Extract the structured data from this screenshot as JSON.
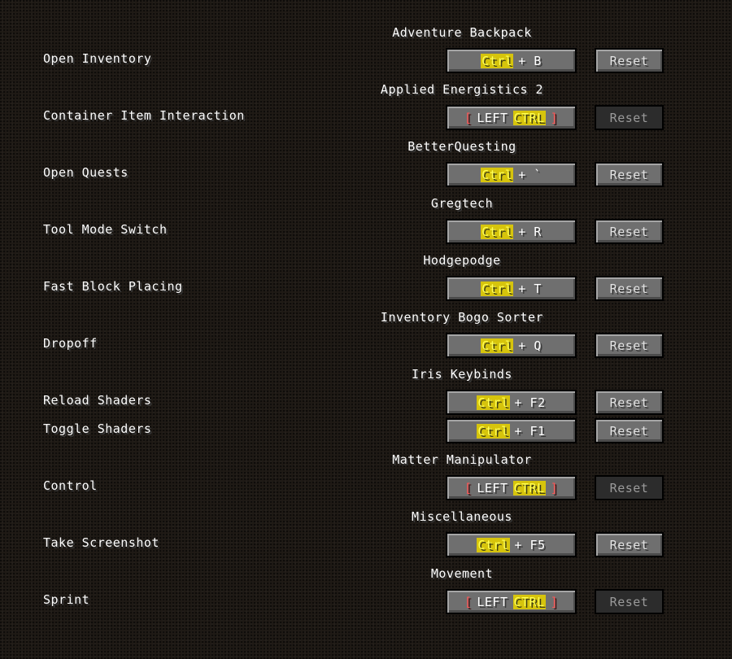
{
  "categories": [
    "Adventure Backpack",
    "Applied Energistics 2",
    "BetterQuesting",
    "Gregtech",
    "Hodgepodge",
    "Inventory Bogo Sorter",
    "Iris Keybinds",
    "Matter Manipulator",
    "Miscellaneous",
    "Movement"
  ],
  "bindings": [
    {
      "label": "Open Inventory",
      "modifier": "Ctrl",
      "key": "+ B",
      "reset": "Reset",
      "reset_enabled": true
    },
    {
      "label": "Container Item Interaction",
      "bracket_open": "[",
      "key_word": "LEFT",
      "modifier": "CTRL",
      "bracket_close": "]",
      "reset": "Reset",
      "reset_enabled": false
    },
    {
      "label": "Open Quests",
      "modifier": "Ctrl",
      "key": "+ `",
      "reset": "Reset",
      "reset_enabled": true
    },
    {
      "label": "Tool Mode Switch",
      "modifier": "Ctrl",
      "key": "+ R",
      "reset": "Reset",
      "reset_enabled": true
    },
    {
      "label": "Fast Block Placing",
      "modifier": "Ctrl",
      "key": "+ T",
      "reset": "Reset",
      "reset_enabled": true
    },
    {
      "label": "Dropoff",
      "modifier": "Ctrl",
      "key": "+ Q",
      "reset": "Reset",
      "reset_enabled": true
    },
    {
      "label": "Reload Shaders",
      "modifier": "Ctrl",
      "key": "+ F2",
      "reset": "Reset",
      "reset_enabled": true
    },
    {
      "label": "Toggle Shaders",
      "modifier": "Ctrl",
      "key": "+ F1",
      "reset": "Reset",
      "reset_enabled": true
    },
    {
      "label": "Control",
      "bracket_open": "[",
      "key_word": "LEFT",
      "modifier": "CTRL",
      "bracket_close": "]",
      "reset": "Reset",
      "reset_enabled": false
    },
    {
      "label": "Take Screenshot",
      "modifier": "Ctrl",
      "key": "+ F5",
      "reset": "Reset",
      "reset_enabled": true
    },
    {
      "label": "Sprint",
      "bracket_open": "[",
      "key_word": "LEFT",
      "modifier": "CTRL",
      "bracket_close": "]",
      "reset": "Reset",
      "reset_enabled": false
    }
  ],
  "colors": {
    "background": "#1f1a15",
    "modifier_highlight": "#d6c40c",
    "modifier_text": "#ffff55",
    "conflict_bracket": "#ff5555",
    "button_face": "#6f6f6f",
    "button_disabled": "#2c2c2c"
  }
}
